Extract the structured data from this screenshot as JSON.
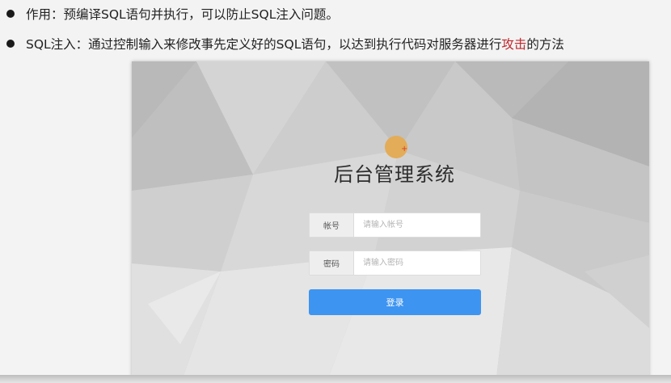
{
  "slide": {
    "bullets": [
      {
        "text": "作用：预编译SQL语句并执行，可以防止SQL注入问题。"
      },
      {
        "text_before": "SQL注入：通过控制输入来修改事先定义好的SQL语句，以达到执行代码对服务器进行",
        "highlight": "攻击",
        "text_after": "的方法"
      }
    ],
    "highlight_color": "#c0272d"
  },
  "login": {
    "title": "后台管理系统",
    "username_label": "帐号",
    "username_placeholder": "请输入帐号",
    "password_label": "密码",
    "password_placeholder": "请输入密码",
    "submit_label": "登录",
    "accent_color": "#3d94f1"
  }
}
